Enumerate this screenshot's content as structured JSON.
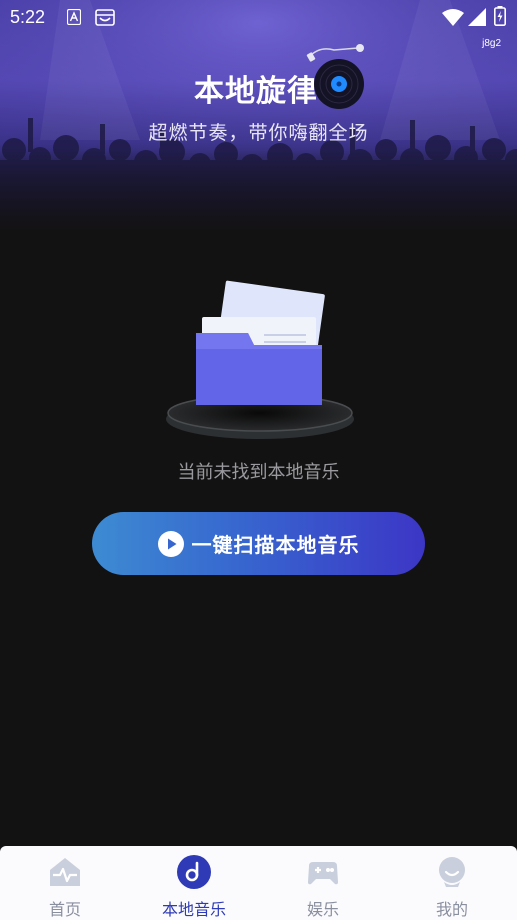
{
  "status_bar": {
    "time": "5:22",
    "icons": [
      "text-a-icon",
      "inbox-icon",
      "wifi-icon",
      "signal-icon",
      "battery-icon"
    ],
    "device_tag": "j8g2"
  },
  "header": {
    "title": "本地旋律",
    "subtitle": "超燃节奏，带你嗨翻全场",
    "icon": "vinyl-record-icon"
  },
  "empty_state": {
    "illustration": "folder-icon",
    "message": "当前未找到本地音乐"
  },
  "scan_button": {
    "label": "一键扫描本地音乐",
    "icon": "play-circle-icon"
  },
  "bottom_nav": {
    "active": "本地音乐",
    "items": [
      {
        "label": "首页",
        "icon": "home-pulse-icon"
      },
      {
        "label": "本地音乐",
        "icon": "music-note-icon"
      },
      {
        "label": "娱乐",
        "icon": "gamepad-icon"
      },
      {
        "label": "我的",
        "icon": "profile-face-icon"
      }
    ]
  },
  "colors": {
    "accent": "#2f3ab6",
    "background": "#131213",
    "banner": "#5447b3",
    "button_start": "#3d8bd2",
    "button_end": "#3c36c6",
    "folder": "#6265e8",
    "nav_inactive": "#8a8fa0"
  }
}
